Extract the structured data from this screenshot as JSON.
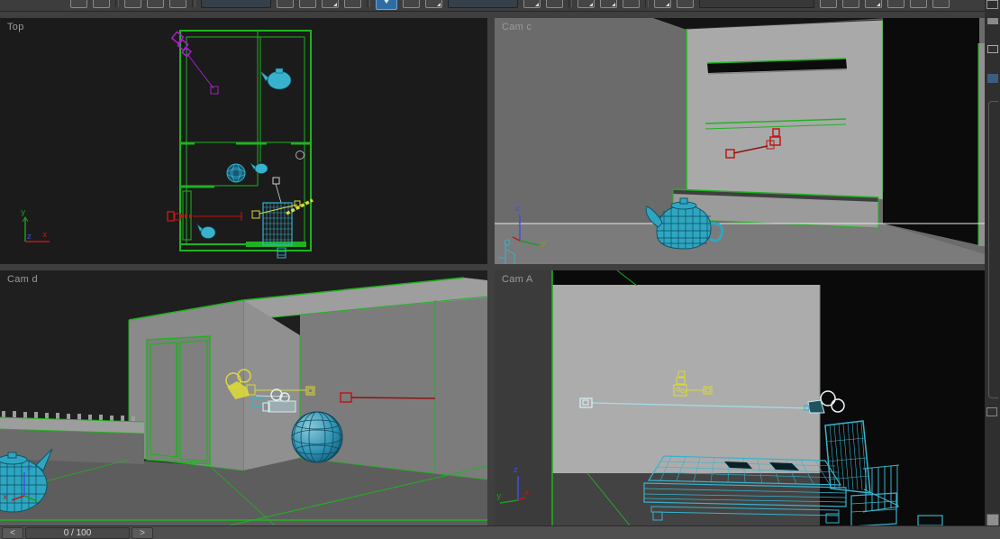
{
  "toolbar": {
    "items": [
      {
        "type": "icon",
        "name": "undo-icon"
      },
      {
        "type": "icon",
        "name": "redo-icon"
      },
      {
        "type": "sep",
        "name": "toolbar-separator"
      },
      {
        "type": "icon",
        "name": "select-and-link-icon"
      },
      {
        "type": "icon",
        "name": "unlink-selection-icon"
      },
      {
        "type": "icon",
        "name": "bind-to-space-warp-icon"
      },
      {
        "type": "sep",
        "name": "toolbar-separator"
      },
      {
        "type": "combo",
        "name": "selection-filter-combo"
      },
      {
        "type": "icon",
        "name": "select-object-icon"
      },
      {
        "type": "icon",
        "name": "select-by-name-icon"
      },
      {
        "type": "icon",
        "name": "selection-region-icon",
        "flyout": true
      },
      {
        "type": "icon",
        "name": "window-crossing-icon"
      },
      {
        "type": "sep",
        "name": "toolbar-separator"
      },
      {
        "type": "icon-active",
        "name": "select-and-move-icon"
      },
      {
        "type": "icon",
        "name": "select-and-rotate-icon"
      },
      {
        "type": "icon",
        "name": "select-and-scale-icon",
        "flyout": true
      },
      {
        "type": "combo",
        "name": "reference-coordinate-combo"
      },
      {
        "type": "icon",
        "name": "use-pivot-center-icon",
        "flyout": true
      },
      {
        "type": "icon",
        "name": "select-and-manipulate-icon"
      },
      {
        "type": "sep",
        "name": "toolbar-separator"
      },
      {
        "type": "icon",
        "name": "snap-toggle-icon",
        "flyout": true
      },
      {
        "type": "icon",
        "name": "angle-snap-icon",
        "flyout": true
      },
      {
        "type": "icon",
        "name": "percent-snap-icon"
      },
      {
        "type": "sep",
        "name": "toolbar-separator"
      },
      {
        "type": "icon",
        "name": "mirror-icon",
        "flyout": true
      },
      {
        "type": "icon",
        "name": "align-icon"
      },
      {
        "type": "combo-wide",
        "name": "named-selection-sets-combo"
      },
      {
        "type": "icon",
        "name": "curve-editor-icon"
      },
      {
        "type": "icon",
        "name": "schematic-view-icon"
      },
      {
        "type": "icon",
        "name": "material-editor-icon",
        "flyout": true
      },
      {
        "type": "icon",
        "name": "render-setup-icon"
      },
      {
        "type": "icon",
        "name": "rendered-frame-icon"
      },
      {
        "type": "icon",
        "name": "render-production-icon"
      }
    ]
  },
  "viewports": {
    "top": {
      "label": "Top"
    },
    "cam_c": {
      "label": "Cam c"
    },
    "cam_d": {
      "label": "Cam d"
    },
    "cam_a": {
      "label": "Cam A"
    }
  },
  "axes": {
    "x": "x",
    "y": "y",
    "z": "z"
  },
  "timeline": {
    "display": "0 / 100",
    "current_frame": 0,
    "total_frames": 100,
    "prev_glyph": "<",
    "next_glyph": ">"
  },
  "colors": {
    "wire_green": "#1fb31f",
    "object_teal": "#38b2cc",
    "selected_red": "#c01616",
    "dark_red": "#8f1212",
    "camera_yellow": "#d9d83a",
    "camera_purple": "#a822c6",
    "camera_white": "#ddf1f5",
    "horizon_white": "#e8e8e8",
    "active_tool_blue": "#2e6da4",
    "axis_x_red": "#c01818",
    "axis_y_green": "#1f9a1f",
    "axis_z_blue": "#4250e0",
    "viewport_label_gray": "#9a9a9a"
  }
}
